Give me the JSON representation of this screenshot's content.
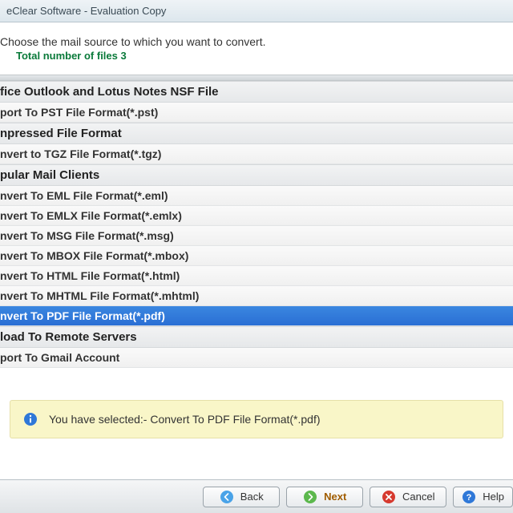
{
  "window": {
    "title": "eClear Software - Evaluation Copy"
  },
  "header": {
    "instruction": "Choose the mail source to which you want to convert.",
    "total_label": "Total number of files 3"
  },
  "groups": [
    {
      "title": "fice Outlook and Lotus Notes NSF File",
      "items": [
        {
          "label": "port To PST File Format(*.pst)",
          "selected": false
        }
      ]
    },
    {
      "title": "npressed File Format",
      "items": [
        {
          "label": "nvert to TGZ File Format(*.tgz)",
          "selected": false
        }
      ]
    },
    {
      "title": "pular Mail Clients",
      "items": [
        {
          "label": "nvert To EML File Format(*.eml)",
          "selected": false
        },
        {
          "label": "nvert To EMLX File Format(*.emlx)",
          "selected": false
        },
        {
          "label": "nvert To MSG File Format(*.msg)",
          "selected": false
        },
        {
          "label": "nvert To MBOX File Format(*.mbox)",
          "selected": false
        },
        {
          "label": "nvert To HTML File Format(*.html)",
          "selected": false
        },
        {
          "label": "nvert To MHTML File Format(*.mhtml)",
          "selected": false
        },
        {
          "label": "nvert To PDF File Format(*.pdf)",
          "selected": true
        }
      ]
    },
    {
      "title": "load To Remote Servers",
      "items": [
        {
          "label": "port To Gmail Account",
          "selected": false
        }
      ]
    }
  ],
  "info": {
    "prefix": "You have selected:- ",
    "value": "Convert To PDF File Format(*.pdf)"
  },
  "buttons": {
    "back": "Back",
    "next": "Next",
    "cancel": "Cancel",
    "help": "Help"
  },
  "colors": {
    "selected_bg": "#2f78d8",
    "accent_green": "#0a7a3a",
    "banner_bg": "#f9f6c8"
  }
}
